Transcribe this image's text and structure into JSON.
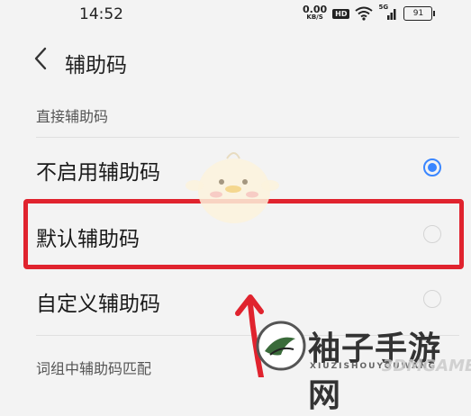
{
  "status_bar": {
    "time": "14:52",
    "net_speed_value": "0.00",
    "net_speed_unit": "KB/S",
    "hd_label": "HD",
    "signal_label": "5G",
    "battery": "91"
  },
  "header": {
    "back_icon": "chevron-left-icon",
    "title": "辅助码"
  },
  "sections": {
    "direct_header": "直接辅助码",
    "options": [
      {
        "label": "不启用辅助码",
        "selected": true
      },
      {
        "label": "默认辅助码",
        "selected": false
      },
      {
        "label": "自定义辅助码",
        "selected": false
      }
    ],
    "phrase_header": "词组中辅助码匹配"
  },
  "colors": {
    "accent": "#3a86ff",
    "highlight": "#e0232e",
    "background": "#f3f3f3"
  },
  "watermark": {
    "text": "袖子手游网",
    "sub": "XIUZISHOUYOUWANG",
    "sub2": "3DMGAME"
  }
}
